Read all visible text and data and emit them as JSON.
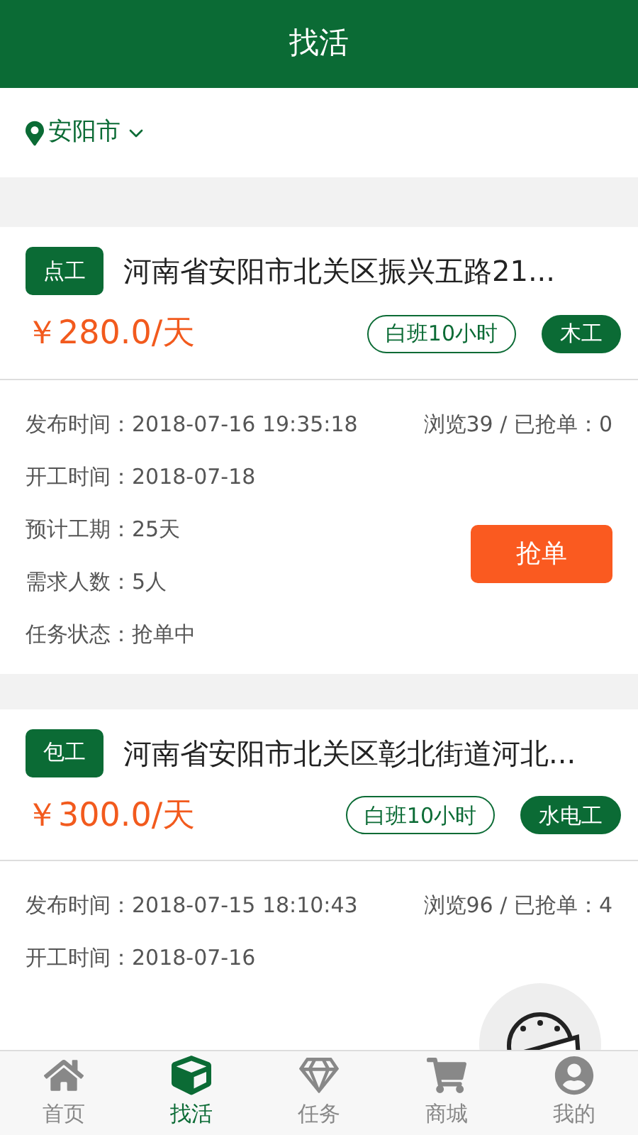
{
  "title": "找活",
  "location": {
    "city": "安阳市"
  },
  "jobs": [
    {
      "type": "点工",
      "address": "河南省安阳市北关区振兴五路21...",
      "price": "￥280.0/天",
      "tags": [
        {
          "label": "白班10小时",
          "kind": "outline"
        },
        {
          "label": "木工",
          "kind": "filled"
        }
      ],
      "details": [
        "发布时间：2018-07-16 19:35:18",
        "开工时间：2018-07-18",
        "预计工期：25天",
        "需求人数：5人",
        "任务状态：抢单中"
      ],
      "stats": "浏览39 / 已抢单：0",
      "action": "抢单"
    },
    {
      "type": "包工",
      "address": "河南省安阳市北关区彰北街道河北...",
      "price": "￥300.0/天",
      "tags": [
        {
          "label": "白班10小时",
          "kind": "outline"
        },
        {
          "label": "水电工",
          "kind": "filled"
        }
      ],
      "details": [
        "发布时间：2018-07-15 18:10:43",
        "开工时间：2018-07-16"
      ],
      "stats": "浏览96 / 已抢单：4"
    }
  ],
  "tabs": [
    {
      "label": "首页",
      "selected": false
    },
    {
      "label": "找活",
      "selected": true
    },
    {
      "label": "任务",
      "selected": false
    },
    {
      "label": "商城",
      "selected": false
    },
    {
      "label": "我的",
      "selected": false
    }
  ]
}
